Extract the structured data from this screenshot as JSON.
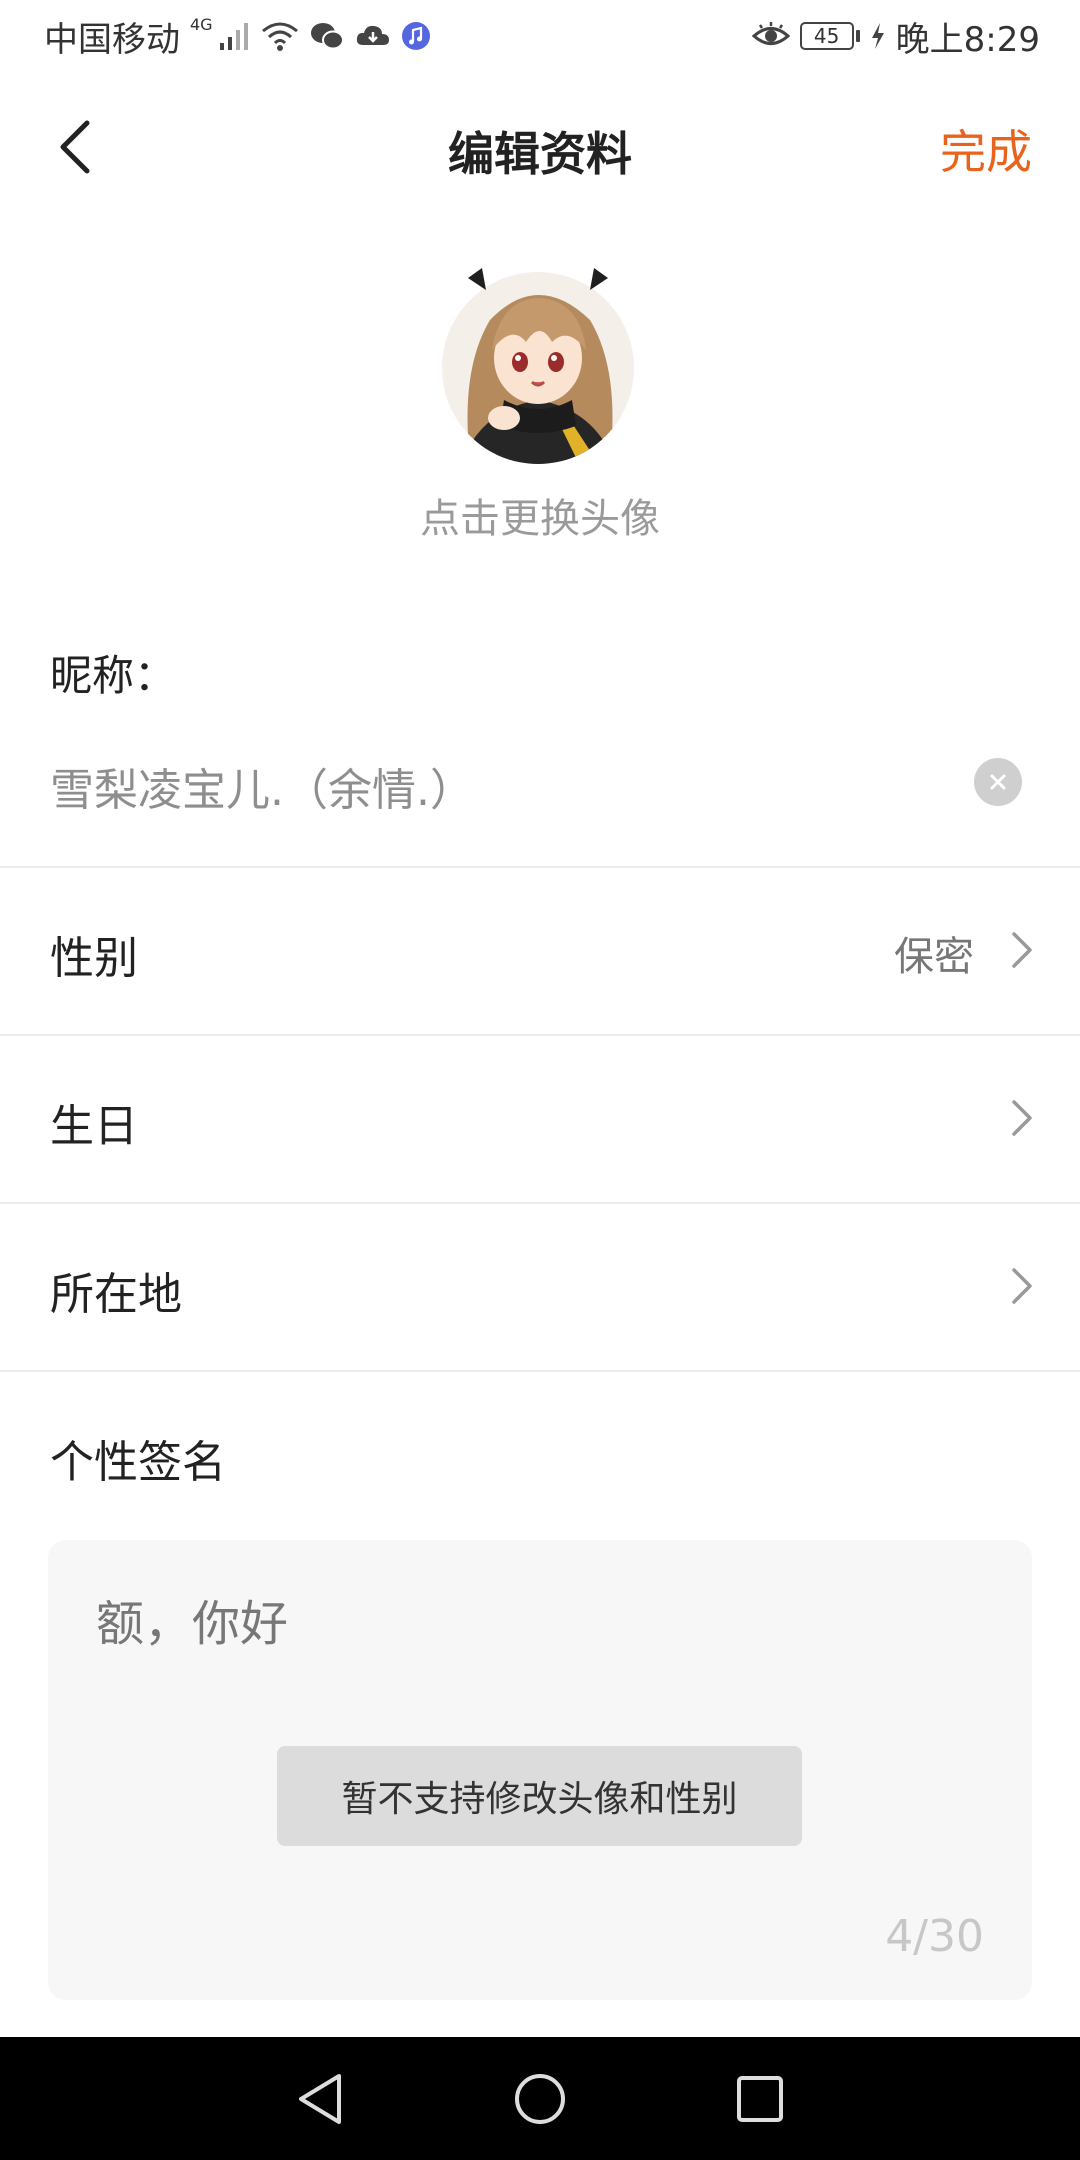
{
  "status_bar": {
    "carrier": "中国移动",
    "network": "4G",
    "battery": "45",
    "time": "晚上8:29"
  },
  "header": {
    "title": "编辑资料",
    "done_label": "完成"
  },
  "avatar": {
    "hint": "点击更换头像"
  },
  "nickname": {
    "label": "昵称：",
    "value": "雪梨凌宝儿.（余情.）"
  },
  "rows": [
    {
      "label": "性别",
      "value": "保密"
    },
    {
      "label": "生日",
      "value": ""
    },
    {
      "label": "所在地",
      "value": ""
    }
  ],
  "signature": {
    "title": "个性签名",
    "text": "额，你好",
    "count": "4/30"
  },
  "toast": {
    "text": "暂不支持修改头像和性别"
  },
  "colors": {
    "accent": "#e8641e",
    "hint_text": "#9a9a9a",
    "divider": "#ececec"
  }
}
